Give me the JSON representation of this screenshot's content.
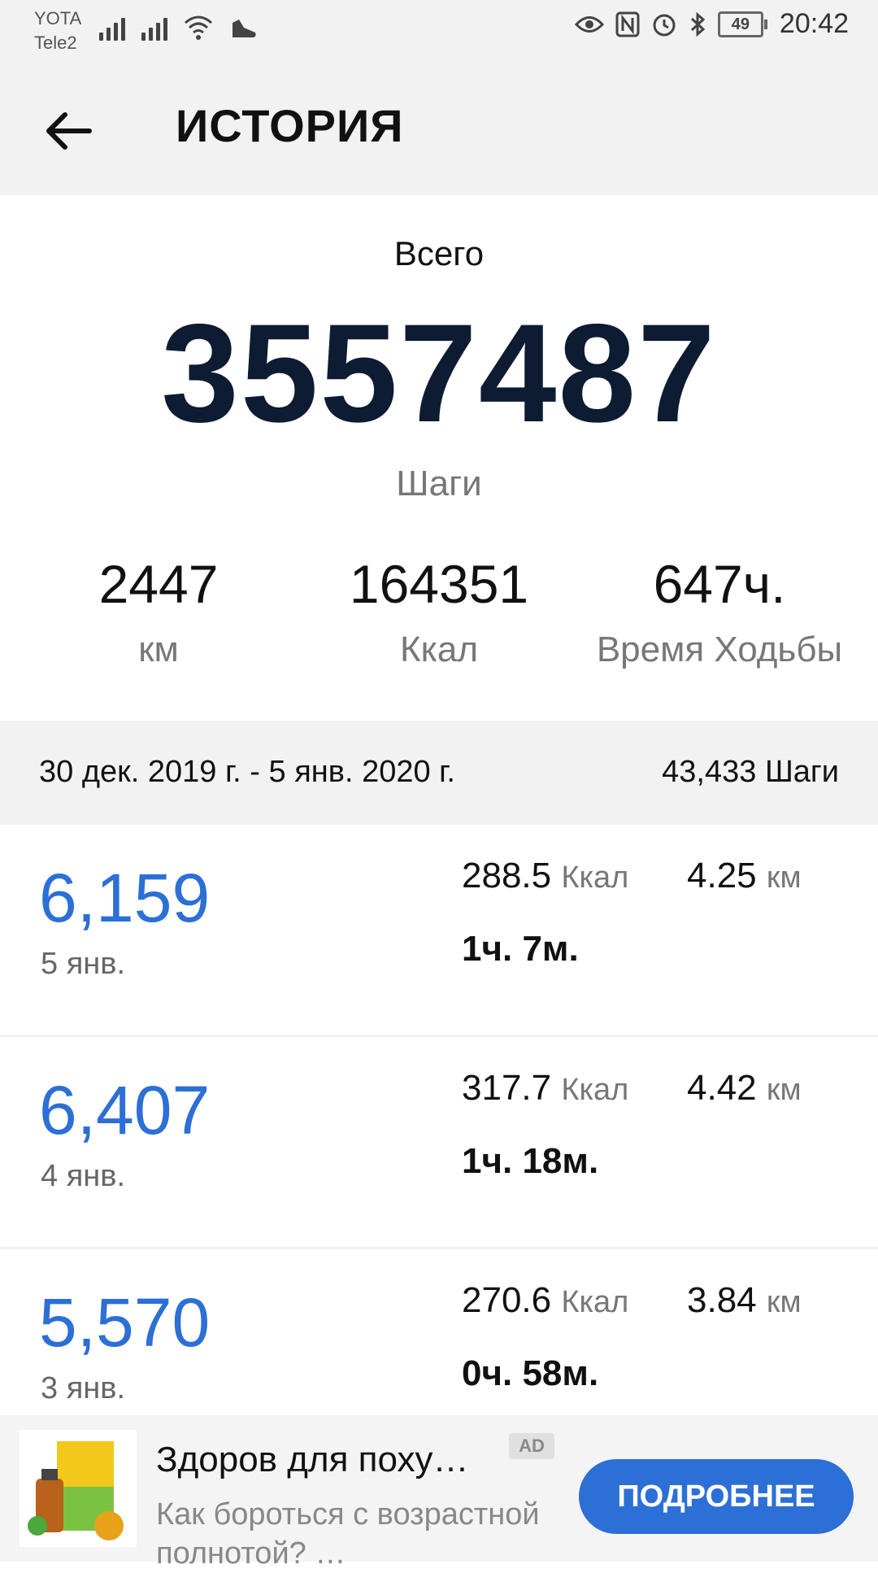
{
  "status_bar": {
    "carrier1": "YOTA",
    "carrier2": "Tele2",
    "battery": "49",
    "time": "20:42"
  },
  "header": {
    "title": "ИСТОРИЯ"
  },
  "summary": {
    "total_label": "Всего",
    "total_steps": "3557487",
    "total_unit": "Шаги",
    "stats": [
      {
        "value": "2447",
        "label": "км"
      },
      {
        "value": "164351",
        "label": "Ккал"
      },
      {
        "value": "647ч.",
        "label": "Время Ходьбы"
      }
    ]
  },
  "week": {
    "range": "30 дек. 2019 г. - 5 янв. 2020 г.",
    "total": "43,433 Шаги"
  },
  "days": [
    {
      "steps": "6,159",
      "date": "5 янв.",
      "kcal": "288.5",
      "kcal_unit": "Ккал",
      "km": "4.25",
      "km_unit": "км",
      "time": "1ч. 7м."
    },
    {
      "steps": "6,407",
      "date": "4 янв.",
      "kcal": "317.7",
      "kcal_unit": "Ккал",
      "km": "4.42",
      "km_unit": "км",
      "time": "1ч. 18м."
    },
    {
      "steps": "5,570",
      "date": "3 янв.",
      "kcal": "270.6",
      "kcal_unit": "Ккал",
      "km": "3.84",
      "km_unit": "км",
      "time": "0ч. 58м."
    }
  ],
  "ad": {
    "title": "Здоров для поху…",
    "badge": "AD",
    "description": "Как бороться с возрастной полнотой? …",
    "button": "ПОДРОБНЕЕ"
  },
  "colors": {
    "accent": "#2c6fd6",
    "header_bg": "#f2f2f2"
  },
  "icons": [
    "signal-icon",
    "wifi-icon",
    "shoe-icon",
    "eye-icon",
    "nfc-icon",
    "alarm-icon",
    "bluetooth-icon",
    "battery-icon",
    "back-arrow-icon"
  ]
}
